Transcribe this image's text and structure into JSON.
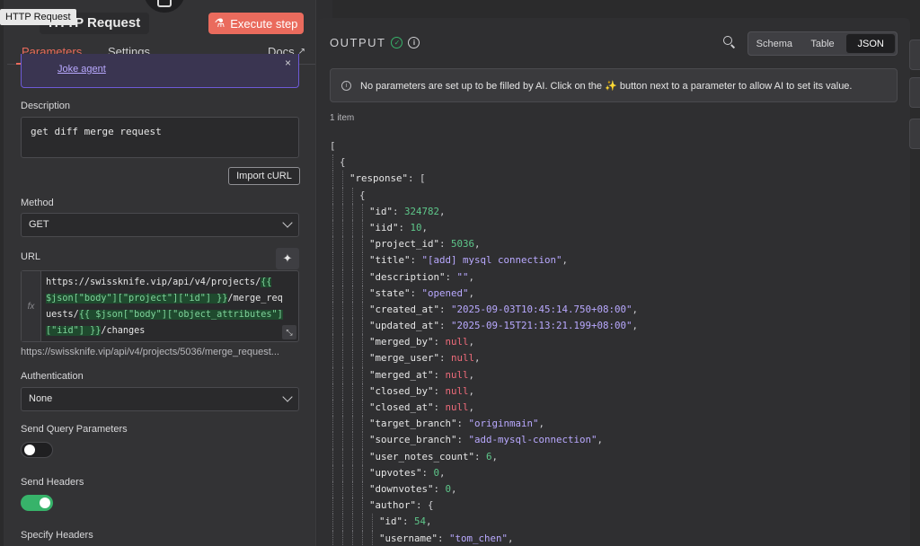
{
  "tooltip": "HTTP Request",
  "node": {
    "title": "HTTP Request",
    "execute_label": "Execute step"
  },
  "tabs": {
    "parameters": "Parameters",
    "settings": "Settings",
    "docs": "Docs"
  },
  "agent": {
    "link": "Joke agent",
    "close": "×"
  },
  "description": {
    "label": "Description",
    "value": "get diff merge request"
  },
  "import_curl": "Import cURL",
  "method": {
    "label": "Method",
    "value": "GET"
  },
  "url": {
    "label": "URL",
    "lines": [
      [
        {
          "t": "https://swissknife.vip/api/v4/projects/",
          "e": false
        },
        {
          "t": "{{",
          "e": true
        }
      ],
      [
        {
          "t": "$json[\"body\"][\"project\"][\"id\"] }}",
          "e": true
        },
        {
          "t": "/merge_req",
          "e": false
        }
      ],
      [
        {
          "t": "uests/",
          "e": false
        },
        {
          "t": "{{ $json[\"body\"][\"object_attributes\"]",
          "e": true
        }
      ],
      [
        {
          "t": "[\"iid\"] }}",
          "e": true
        },
        {
          "t": "/changes",
          "e": false
        }
      ]
    ],
    "preview": "https://swissknife.vip/api/v4/projects/5036/merge_request..."
  },
  "authentication": {
    "label": "Authentication",
    "value": "None"
  },
  "send_query": {
    "label": "Send Query Parameters",
    "on": false
  },
  "send_headers": {
    "label": "Send Headers",
    "on": true
  },
  "specify_headers": {
    "label": "Specify Headers"
  },
  "output": {
    "title": "OUTPUT",
    "views": [
      "Schema",
      "Table",
      "JSON"
    ],
    "active_view": "JSON",
    "notice": "No parameters are set up to be filled by AI. Click on the ✨ button next to a parameter to allow AI to set its value.",
    "count": "1 item"
  },
  "json_lines": [
    {
      "d": 0,
      "p": [
        [
          "b",
          "["
        ]
      ]
    },
    {
      "d": 1,
      "p": [
        [
          "b",
          "{"
        ]
      ]
    },
    {
      "d": 2,
      "p": [
        [
          "k",
          "\"response\""
        ],
        [
          "p",
          ": "
        ],
        [
          "b",
          "["
        ]
      ]
    },
    {
      "d": 3,
      "p": [
        [
          "b",
          "{"
        ]
      ]
    },
    {
      "d": 4,
      "p": [
        [
          "k",
          "\"id\""
        ],
        [
          "p",
          ": "
        ],
        [
          "n",
          "324782"
        ],
        [
          "p",
          ","
        ]
      ]
    },
    {
      "d": 4,
      "p": [
        [
          "k",
          "\"iid\""
        ],
        [
          "p",
          ": "
        ],
        [
          "n",
          "10"
        ],
        [
          "p",
          ","
        ]
      ]
    },
    {
      "d": 4,
      "p": [
        [
          "k",
          "\"project_id\""
        ],
        [
          "p",
          ": "
        ],
        [
          "n",
          "5036"
        ],
        [
          "p",
          ","
        ]
      ]
    },
    {
      "d": 4,
      "p": [
        [
          "k",
          "\"title\""
        ],
        [
          "p",
          ": "
        ],
        [
          "s",
          "\"[add] mysql connection\""
        ],
        [
          "p",
          ","
        ]
      ]
    },
    {
      "d": 4,
      "p": [
        [
          "k",
          "\"description\""
        ],
        [
          "p",
          ": "
        ],
        [
          "s",
          "\"\""
        ],
        [
          "p",
          ","
        ]
      ]
    },
    {
      "d": 4,
      "p": [
        [
          "k",
          "\"state\""
        ],
        [
          "p",
          ": "
        ],
        [
          "s",
          "\"opened\""
        ],
        [
          "p",
          ","
        ]
      ]
    },
    {
      "d": 4,
      "p": [
        [
          "k",
          "\"created_at\""
        ],
        [
          "p",
          ": "
        ],
        [
          "s",
          "\"2025-09-03T10:45:14.750+08:00\""
        ],
        [
          "p",
          ","
        ]
      ]
    },
    {
      "d": 4,
      "p": [
        [
          "k",
          "\"updated_at\""
        ],
        [
          "p",
          ": "
        ],
        [
          "s",
          "\"2025-09-15T21:13:21.199+08:00\""
        ],
        [
          "p",
          ","
        ]
      ]
    },
    {
      "d": 4,
      "p": [
        [
          "k",
          "\"merged_by\""
        ],
        [
          "p",
          ": "
        ],
        [
          "x",
          "null"
        ],
        [
          "p",
          ","
        ]
      ]
    },
    {
      "d": 4,
      "p": [
        [
          "k",
          "\"merge_user\""
        ],
        [
          "p",
          ": "
        ],
        [
          "x",
          "null"
        ],
        [
          "p",
          ","
        ]
      ]
    },
    {
      "d": 4,
      "p": [
        [
          "k",
          "\"merged_at\""
        ],
        [
          "p",
          ": "
        ],
        [
          "x",
          "null"
        ],
        [
          "p",
          ","
        ]
      ]
    },
    {
      "d": 4,
      "p": [
        [
          "k",
          "\"closed_by\""
        ],
        [
          "p",
          ": "
        ],
        [
          "x",
          "null"
        ],
        [
          "p",
          ","
        ]
      ]
    },
    {
      "d": 4,
      "p": [
        [
          "k",
          "\"closed_at\""
        ],
        [
          "p",
          ": "
        ],
        [
          "x",
          "null"
        ],
        [
          "p",
          ","
        ]
      ]
    },
    {
      "d": 4,
      "p": [
        [
          "k",
          "\"target_branch\""
        ],
        [
          "p",
          ": "
        ],
        [
          "s",
          "\"originmain\""
        ],
        [
          "p",
          ","
        ]
      ]
    },
    {
      "d": 4,
      "p": [
        [
          "k",
          "\"source_branch\""
        ],
        [
          "p",
          ": "
        ],
        [
          "s",
          "\"add-mysql-connection\""
        ],
        [
          "p",
          ","
        ]
      ]
    },
    {
      "d": 4,
      "p": [
        [
          "k",
          "\"user_notes_count\""
        ],
        [
          "p",
          ": "
        ],
        [
          "n",
          "6"
        ],
        [
          "p",
          ","
        ]
      ]
    },
    {
      "d": 4,
      "p": [
        [
          "k",
          "\"upvotes\""
        ],
        [
          "p",
          ": "
        ],
        [
          "n",
          "0"
        ],
        [
          "p",
          ","
        ]
      ]
    },
    {
      "d": 4,
      "p": [
        [
          "k",
          "\"downvotes\""
        ],
        [
          "p",
          ": "
        ],
        [
          "n",
          "0"
        ],
        [
          "p",
          ","
        ]
      ]
    },
    {
      "d": 4,
      "p": [
        [
          "k",
          "\"author\""
        ],
        [
          "p",
          ": "
        ],
        [
          "b",
          "{"
        ]
      ]
    },
    {
      "d": 5,
      "p": [
        [
          "k",
          "\"id\""
        ],
        [
          "p",
          ": "
        ],
        [
          "n",
          "54"
        ],
        [
          "p",
          ","
        ]
      ]
    },
    {
      "d": 5,
      "p": [
        [
          "k",
          "\"username\""
        ],
        [
          "p",
          ": "
        ],
        [
          "s",
          "\"tom_chen\""
        ],
        [
          "p",
          ","
        ]
      ]
    }
  ]
}
